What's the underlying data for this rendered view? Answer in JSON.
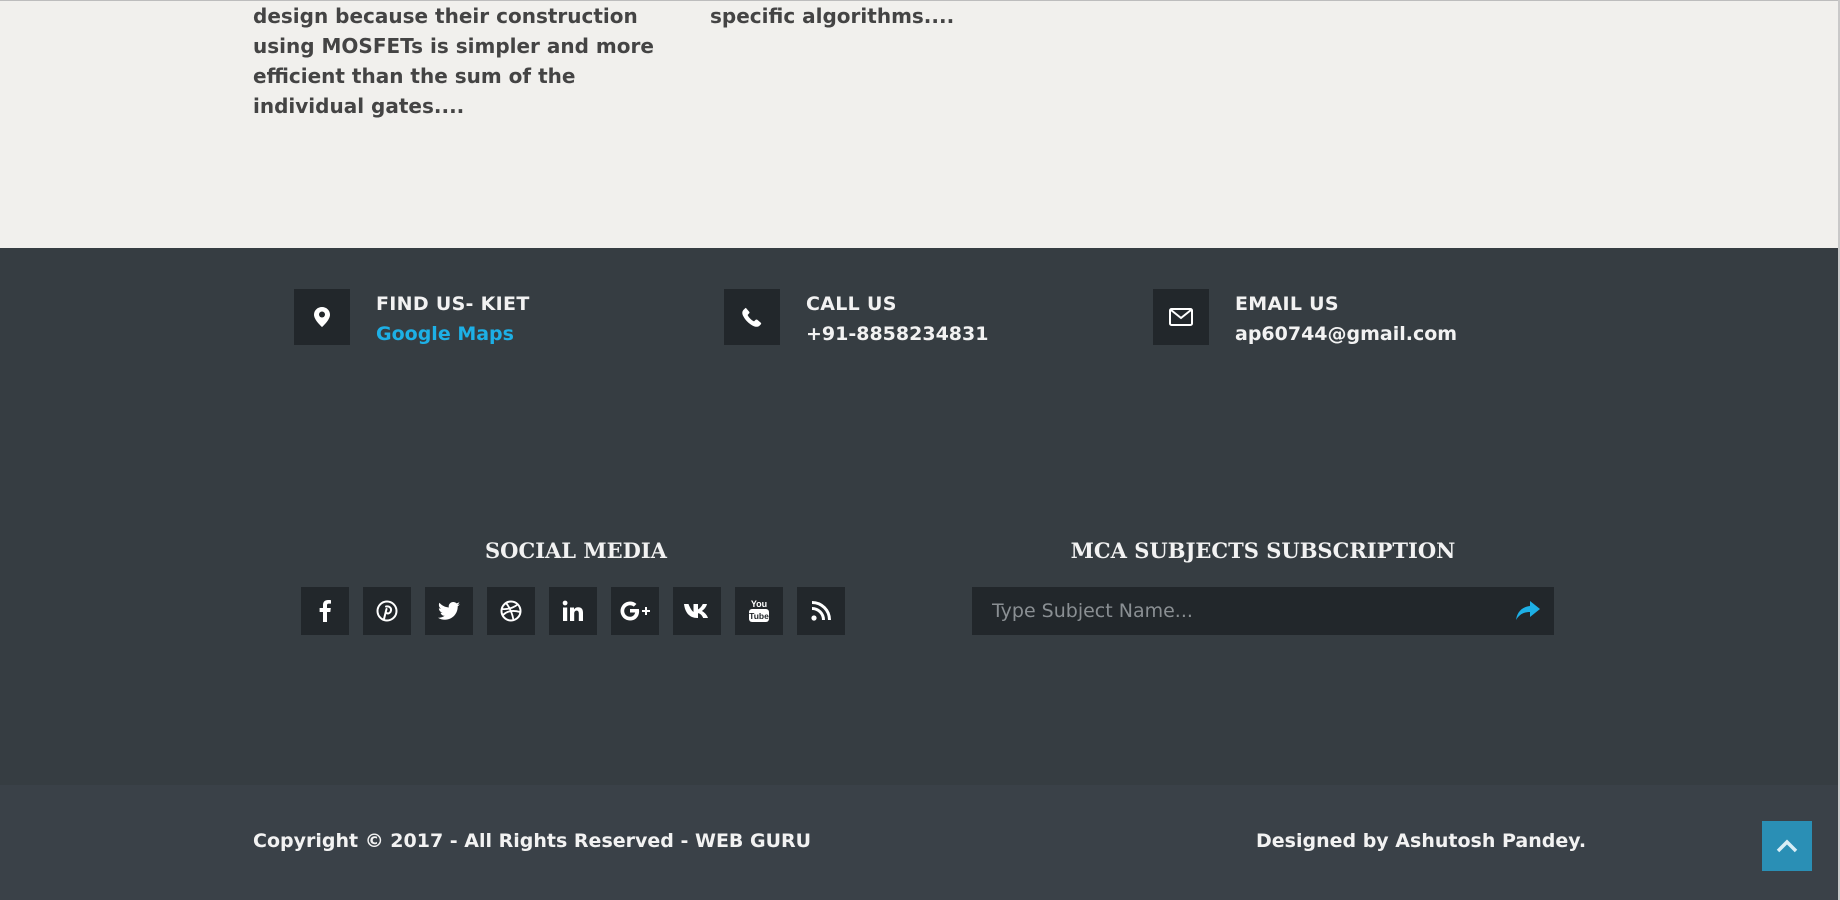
{
  "articles": {
    "excerpt_left": "design because their construction using MOSFETs is simpler and more efficient than the sum of the individual gates....",
    "excerpt_right": "specific algorithms...."
  },
  "contact": {
    "find": {
      "heading": "FIND US- KIET",
      "value": "Google Maps",
      "icon": "map-marker-icon"
    },
    "call": {
      "heading": "CALL US",
      "value": "+91-8858234831",
      "icon": "phone-icon"
    },
    "email": {
      "heading": "EMAIL US",
      "value": "ap60744@gmail.com",
      "icon": "envelope-icon"
    }
  },
  "social": {
    "title": "SOCIAL MEDIA",
    "icons": [
      "facebook-icon",
      "pinterest-icon",
      "twitter-icon",
      "dribbble-icon",
      "linkedin-icon",
      "google-plus-icon",
      "vk-icon",
      "youtube-icon",
      "rss-icon"
    ]
  },
  "subscription": {
    "title": "MCA SUBJECTS SUBSCRIPTION",
    "placeholder": "Type Subject Name...",
    "submit_icon": "share-arrow-icon"
  },
  "footer": {
    "copyright": "Copyright © 2017 - All Rights Reserved - WEB GURU",
    "designed_by": "Designed by Ashutosh Pandey.",
    "back_to_top_icon": "chevron-up-icon"
  },
  "colors": {
    "page_bg": "#f1f0ed",
    "footer_bg": "#363d42",
    "footer_bottom_bg": "#3a4148",
    "icon_box_bg": "#22272b",
    "link": "#1db0e6",
    "back_to_top": "#2a8fb5"
  }
}
